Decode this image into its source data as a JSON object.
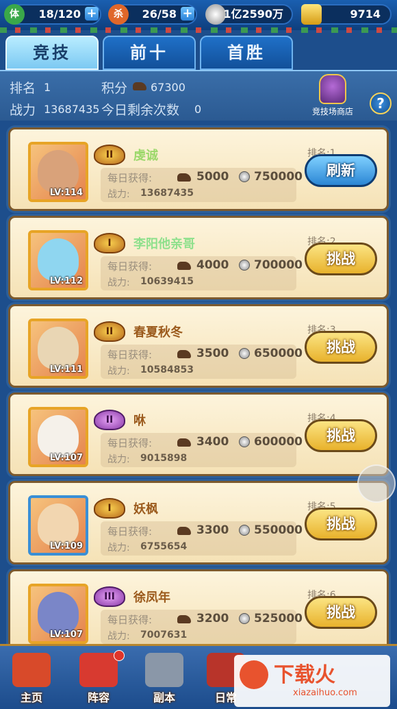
{
  "resources": {
    "stamina": {
      "icon_label": "体",
      "value": "18/120"
    },
    "kill": {
      "icon_label": "杀",
      "value": "26/58"
    },
    "coins": {
      "value": "1亿2590万"
    },
    "gold": {
      "value": "9714"
    }
  },
  "tabs": [
    "竞技",
    "前十",
    "首胜"
  ],
  "info": {
    "rank_label": "排名",
    "rank_value": "1",
    "score_label": "积分",
    "score_value": "67300",
    "power_label": "战力",
    "power_value": "13687435",
    "remaining_label": "今日剩余次数",
    "remaining_value": "0",
    "shop_label": "竞技场商店",
    "help_label": "?"
  },
  "labels": {
    "daily": "每日获得:",
    "power": "战力:"
  },
  "players": [
    {
      "name": "虔诚",
      "name_color": "#9bd86a",
      "tier": "II",
      "tier_style": "gold",
      "level": "LV:114",
      "rank": "排名:1",
      "horses": "5000",
      "coins": "750000",
      "power": "13687435",
      "action": "刷新",
      "action_style": "blue",
      "face_color": "#d9a27a"
    },
    {
      "name": "李阳他亲哥",
      "name_color": "#8ee08c",
      "tier": "I",
      "tier_style": "gold",
      "level": "LV:112",
      "rank": "排名:2",
      "horses": "4000",
      "coins": "700000",
      "power": "10639415",
      "action": "挑战",
      "action_style": "gold",
      "face_color": "#8fd6f0"
    },
    {
      "name": "春夏秋冬",
      "name_color": "#9b5a1c",
      "tier": "II",
      "tier_style": "gold",
      "level": "LV:111",
      "rank": "排名:3",
      "horses": "3500",
      "coins": "650000",
      "power": "10584853",
      "action": "挑战",
      "action_style": "gold",
      "face_color": "#e9d6b4"
    },
    {
      "name": "咻",
      "name_color": "#9b5a1c",
      "tier": "II",
      "tier_style": "purple",
      "level": "LV:107",
      "rank": "排名:4",
      "horses": "3400",
      "coins": "600000",
      "power": "9015898",
      "action": "挑战",
      "action_style": "gold",
      "face_color": "#f5f1ea"
    },
    {
      "name": "妖枫",
      "name_color": "#9b5a1c",
      "tier": "I",
      "tier_style": "gold",
      "level": "LV:109",
      "rank": "排名:5",
      "horses": "3300",
      "coins": "550000",
      "power": "6755654",
      "action": "挑战",
      "action_style": "gold",
      "face_color": "#f2d6b0"
    },
    {
      "name": "徐凤年",
      "name_color": "#9b5a1c",
      "tier": "III",
      "tier_style": "purple",
      "level": "LV:107",
      "rank": "排名:6",
      "horses": "3200",
      "coins": "525000",
      "power": "7007631",
      "action": "挑战",
      "action_style": "gold",
      "face_color": "#7a86c8"
    }
  ],
  "nav": [
    {
      "label": "主页",
      "icon": "palace-icon",
      "color": "#d84a2a"
    },
    {
      "label": "阵容",
      "icon": "banner-icon",
      "color": "#d83a30"
    },
    {
      "label": "副本",
      "icon": "sword-icon",
      "color": "#8a97a8"
    },
    {
      "label": "日常",
      "icon": "scroll-icon",
      "color": "#b8342a"
    }
  ],
  "watermark": {
    "title": "下载火",
    "url": "xiazaihuo.com"
  }
}
